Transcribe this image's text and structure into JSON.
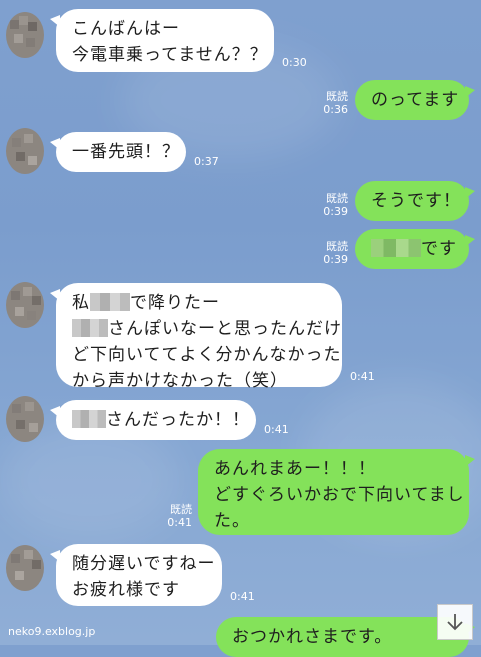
{
  "messages": [
    {
      "from": "other",
      "lines": [
        "こんばんはー",
        "今電車乗ってません？？"
      ],
      "time": "0:30"
    },
    {
      "from": "me",
      "read_label": "既読",
      "time": "0:36",
      "text": "のってます"
    },
    {
      "from": "other",
      "lines": [
        "一番先頭！？"
      ],
      "time": "0:37"
    },
    {
      "from": "me",
      "read_label": "既読",
      "time": "0:39",
      "text": "そうです！"
    },
    {
      "from": "me",
      "read_label": "既読",
      "time": "0:39",
      "text_suffix": "です"
    },
    {
      "from": "other",
      "line1_prefix": "私",
      "line1_suffix": "で降りたー",
      "line2_suffix": "さんぽいなーと思ったんだけ",
      "line3": "ど下向いててよく分かんなかった",
      "line4": "から声かけなかった（笑）",
      "time": "0:41"
    },
    {
      "from": "other",
      "text_suffix": "さんだったか！！",
      "time": "0:41"
    },
    {
      "from": "me",
      "read_label": "既読",
      "time": "0:41",
      "lines": [
        "あんれまあー！！！",
        "どすぐろいかおで下向いてまし",
        "た。"
      ]
    },
    {
      "from": "other",
      "lines": [
        "随分遅いですねー",
        "お疲れ様です"
      ],
      "time": "0:41"
    },
    {
      "from": "me",
      "text": "おつかれさまです。"
    }
  ],
  "watermark": "neko9.exblog.jp",
  "scroll_button_icon": "arrow-down-icon",
  "colors": {
    "outgoing_bubble": "#84e25a",
    "incoming_bubble": "#ffffff",
    "background": "#7fa0cf"
  }
}
